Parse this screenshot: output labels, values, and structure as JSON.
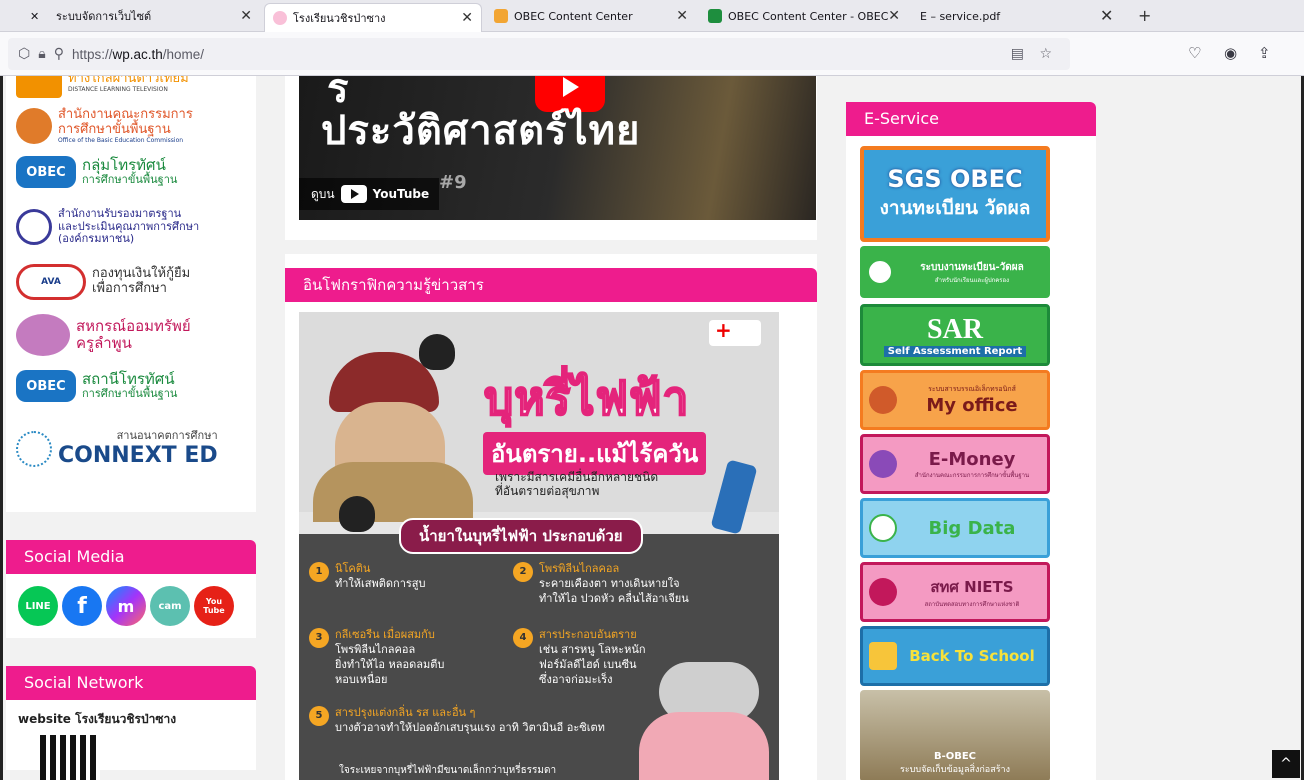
{
  "tabs": [
    {
      "title": "ระบบจัดการเว็บไซต์",
      "active": false
    },
    {
      "title": "โรงเรียนวชิรป่าซาง",
      "active": true
    },
    {
      "title": "OBEC Content Center",
      "active": false
    },
    {
      "title": "OBEC Content Center - OBEC",
      "active": false
    },
    {
      "title": "E – service.pdf",
      "active": false
    }
  ],
  "url": {
    "host": "wp.ac.th",
    "scheme": "https://",
    "path": "/home/"
  },
  "left": {
    "logos": [
      {
        "line1": "ทางไกลผ่านดาวเทียม",
        "sub": "DISTANCE LEARNING TELEVISION"
      },
      {
        "line1": "สำนักงานคณะกรรมการ",
        "line2": "การศึกษาขั้นพื้นฐาน",
        "sub": "Office of the Basic Education Commission"
      },
      {
        "line1": "กลุ่มโทรทัศน์",
        "line2": "การศึกษาขั้นพื้นฐาน"
      },
      {
        "line1": "สำนักงานรับรองมาตรฐาน",
        "line2": "และประเมินคุณภาพการศึกษา",
        "line3": "(องค์กรมหาชน)"
      },
      {
        "line1": "กองทุนเงินให้กู้ยืม",
        "line2": "เพื่อการศึกษา"
      },
      {
        "line1": "สหกรณ์ออมทรัพย์",
        "line2": "ครูลำพูน"
      },
      {
        "line1": "สถานีโทรทัศน์",
        "line2": "การศึกษาขั้นพื้นฐาน"
      },
      {
        "line1": "สานอนาคตการศึกษา",
        "line2": "CONNEXT ED"
      }
    ],
    "social_media_title": "Social Media",
    "social_icons": [
      "LINE",
      "f",
      "m",
      "cam",
      "You Tube"
    ],
    "social_network_title": "Social Network",
    "social_network_text": "website โรงเรียนวชิรป่าซาง"
  },
  "center": {
    "banner": {
      "title": "ประวัติศาสตร์ไทย",
      "watch_label": "ดูบน",
      "yt_label": "YouTube",
      "episode": "#9"
    },
    "info_title": "อินโฟกราฟิกความรู้ข่าวสาร",
    "poster": {
      "title": "บุหรี่ไฟฟ้า",
      "subtitle": "อันตราย..แม้ไร้ควัน",
      "desc1": "เพราะมีสารเคมีอื่นอีกหลายชนิด",
      "desc2": "ที่อันตรายต่อสุขภาพ",
      "pill": "น้ำยาในบุหรี่ไฟฟ้า ประกอบด้วย",
      "items": [
        {
          "n": "1",
          "t1": "นิโคติน",
          "t2": "ทำให้เสพติดการสูบ"
        },
        {
          "n": "2",
          "t1": "โพรพิลีนไกลคอล",
          "t2": "ระคายเคืองตา ทางเดินหายใจ",
          "t3": "ทำให้ไอ ปวดหัว คลื่นไส้อาเจียน"
        },
        {
          "n": "3",
          "t1": "กลีเซอรีน เมื่อผสมกับ",
          "t2": "โพรพิลีนไกลคอล",
          "t3": "ยิ่งทำให้ไอ หลอดลมตีบ",
          "t4": "หอบเหนื่อย"
        },
        {
          "n": "4",
          "t1": "สารประกอบอันตราย",
          "t2": "เช่น สารหนู โลหะหนัก",
          "t3": "ฟอร์มัลดีไฮด์ เบนซีน",
          "t4": "ซึ่งอาจก่อมะเร็ง"
        },
        {
          "n": "5",
          "t1": "สารปรุงแต่งกลิ่น รส และอื่น ๆ",
          "t2": "บางตัวอาจทำให้ปอดอักเสบรุนแรง อาทิ วิตามินอี อะซิเตท"
        }
      ],
      "footer": "ใจระเหยจากบุหรี่ไฟฟ้ามีขนาดเล็กกว่าบุหรี่ธรรมดา"
    }
  },
  "right": {
    "title": "E-Service",
    "items": [
      {
        "name": "SGS OBEC",
        "sub": "งานทะเบียน วัดผล",
        "bg": "#3aa0d8",
        "border": "#f47b20"
      },
      {
        "name": "ระบบงานทะเบียน-วัดผล",
        "sub": "สำหรับนักเรียนและผู้ปกครอง",
        "bg": "#3ab34a",
        "border": "#ffffff"
      },
      {
        "name": "SAR",
        "sub": "Self Assessment Report",
        "bg": "#3ab34a",
        "border": "#1d8a3a"
      },
      {
        "name": "My office",
        "sub": "ระบบสารบรรณอิเล็กทรอนิกส์",
        "bg": "#f7a34a",
        "border": "#f47b20"
      },
      {
        "name": "E-Money",
        "sub": "สำนักงานคณะกรรมการการศึกษาขั้นพื้นฐาน",
        "bg": "#f49ac2",
        "border": "#c2185b"
      },
      {
        "name": "Big Data",
        "sub": "",
        "bg": "#8fd3ef",
        "border": "#3aa0d8"
      },
      {
        "name": "สทศ NIETS",
        "sub": "สถาบันทดสอบทางการศึกษาแห่งชาติ",
        "bg": "#f49ac2",
        "border": "#c2185b"
      },
      {
        "name": "Back To School",
        "sub": "",
        "bg": "#3aa0d8",
        "border": "#1d6fa8"
      },
      {
        "name": "B-OBEC",
        "sub": "ระบบจัดเก็บข้อมูลสิ่งก่อสร้าง",
        "bg": "#8d7a55",
        "border": "#ffffff"
      }
    ]
  },
  "colors": {
    "accent": "#ee1c8d"
  }
}
